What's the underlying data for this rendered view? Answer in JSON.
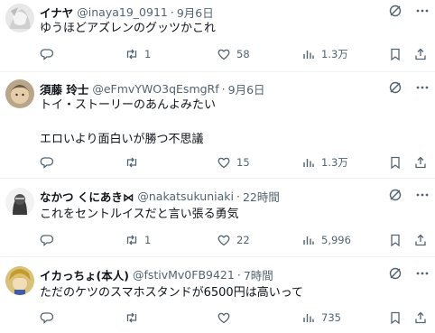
{
  "tweets": [
    {
      "name": "イナヤ",
      "handle": "@inaya19_0911",
      "separator": "·",
      "time": "9月6日",
      "text": "ゆうほどアズレンのグッツかこれ",
      "replies": "",
      "retweets": "1",
      "likes": "58",
      "views": "1.3万"
    },
    {
      "name": "須藤 玲士",
      "handle": "@eFmvYWO3qEsmgRf",
      "separator": "·",
      "time": "9月6日",
      "text": "トイ・ストーリーのあんよみたい\n\nエロいより面白いが勝つ不思議",
      "replies": "",
      "retweets": "",
      "likes": "15",
      "views": "1.3万"
    },
    {
      "name": "なかつ くにあき⋈",
      "handle": "@nakatsukuniaki",
      "separator": "·",
      "time": "22時間",
      "text": "これをセントルイスだと言い張る勇気",
      "replies": "",
      "retweets": "1",
      "likes": "22",
      "views": "5,996"
    },
    {
      "name": "イカっちょ(本人)",
      "handle": "@fstivMv0FB9421",
      "separator": "·",
      "time": "7時間",
      "text": "ただのケツのスマホスタンドが6500円は高いって",
      "replies": "",
      "retweets": "",
      "likes": "",
      "views": "735"
    }
  ],
  "colors": {
    "text": "#0f1419",
    "secondary": "#536471",
    "divider": "#eff3f4"
  },
  "icons": [
    "grok-icon",
    "more-icon",
    "reply-icon",
    "retweet-icon",
    "like-icon",
    "views-icon",
    "bookmark-icon",
    "share-icon"
  ]
}
